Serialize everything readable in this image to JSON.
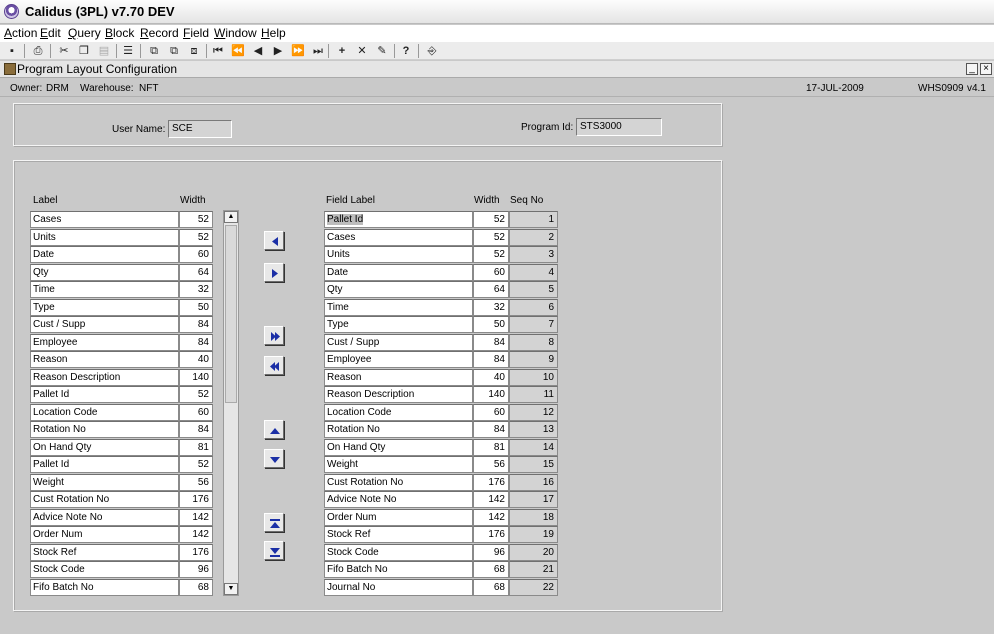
{
  "window": {
    "title": "Calidus (3PL) v7.70 DEV"
  },
  "menu": [
    {
      "label": "Action",
      "u": "A",
      "rest": "ction"
    },
    {
      "label": "Edit",
      "u": "E",
      "rest": "dit"
    },
    {
      "label": "Query",
      "u": "Q",
      "rest": "uery"
    },
    {
      "label": "Block",
      "u": "B",
      "rest": "lock"
    },
    {
      "label": "Record",
      "u": "R",
      "rest": "ecord"
    },
    {
      "label": "Field",
      "u": "F",
      "rest": "ield"
    },
    {
      "label": "Window",
      "u": "W",
      "rest": "indow"
    },
    {
      "label": "Help",
      "u": "H",
      "rest": "elp"
    }
  ],
  "form": {
    "title": "Program Layout Configuration",
    "owner_label": "Owner:",
    "owner_value": "DRM",
    "warehouse_label": "Warehouse:",
    "warehouse_value": "NFT",
    "date": "17-JUL-2009",
    "screen_id": "WHS0909",
    "version": "v4.1"
  },
  "header_panel": {
    "user_name_label": "User Name:",
    "user_name_value": "SCE",
    "program_id_label": "Program Id:",
    "program_id_value": "STS3000"
  },
  "available": {
    "col_label": "Label",
    "col_width": "Width",
    "rows": [
      {
        "label": "Cases",
        "width": "52"
      },
      {
        "label": "Units",
        "width": "52"
      },
      {
        "label": "Date",
        "width": "60"
      },
      {
        "label": "Qty",
        "width": "64"
      },
      {
        "label": "Time",
        "width": "32"
      },
      {
        "label": "Type",
        "width": "50"
      },
      {
        "label": "Cust / Supp",
        "width": "84"
      },
      {
        "label": "Employee",
        "width": "84"
      },
      {
        "label": "Reason",
        "width": "40"
      },
      {
        "label": "Reason Description",
        "width": "140"
      },
      {
        "label": "Pallet Id",
        "width": "52"
      },
      {
        "label": "Location Code",
        "width": "60"
      },
      {
        "label": "Rotation No",
        "width": "84"
      },
      {
        "label": "On Hand Qty",
        "width": "81"
      },
      {
        "label": "Pallet Id",
        "width": "52"
      },
      {
        "label": "Weight",
        "width": "56"
      },
      {
        "label": "Cust Rotation No",
        "width": "176"
      },
      {
        "label": "Advice Note No",
        "width": "142"
      },
      {
        "label": "Order Num",
        "width": "142"
      },
      {
        "label": "Stock Ref",
        "width": "176"
      },
      {
        "label": "Stock Code",
        "width": "96"
      },
      {
        "label": "Fifo Batch No",
        "width": "68"
      }
    ]
  },
  "selected": {
    "col_label": "Field Label",
    "col_width": "Width",
    "col_seq": "Seq No",
    "rows": [
      {
        "label": "Pallet Id",
        "width": "52",
        "seq": "1"
      },
      {
        "label": "Cases",
        "width": "52",
        "seq": "2"
      },
      {
        "label": "Units",
        "width": "52",
        "seq": "3"
      },
      {
        "label": "Date",
        "width": "60",
        "seq": "4"
      },
      {
        "label": "Qty",
        "width": "64",
        "seq": "5"
      },
      {
        "label": "Time",
        "width": "32",
        "seq": "6"
      },
      {
        "label": "Type",
        "width": "50",
        "seq": "7"
      },
      {
        "label": "Cust / Supp",
        "width": "84",
        "seq": "8"
      },
      {
        "label": "Employee",
        "width": "84",
        "seq": "9"
      },
      {
        "label": "Reason",
        "width": "40",
        "seq": "10"
      },
      {
        "label": "Reason Description",
        "width": "140",
        "seq": "11"
      },
      {
        "label": "Location Code",
        "width": "60",
        "seq": "12"
      },
      {
        "label": "Rotation No",
        "width": "84",
        "seq": "13"
      },
      {
        "label": "On Hand Qty",
        "width": "81",
        "seq": "14"
      },
      {
        "label": "Weight",
        "width": "56",
        "seq": "15"
      },
      {
        "label": "Cust Rotation No",
        "width": "176",
        "seq": "16"
      },
      {
        "label": "Advice Note No",
        "width": "142",
        "seq": "17"
      },
      {
        "label": "Order Num",
        "width": "142",
        "seq": "18"
      },
      {
        "label": "Stock Ref",
        "width": "176",
        "seq": "19"
      },
      {
        "label": "Stock Code",
        "width": "96",
        "seq": "20"
      },
      {
        "label": "Fifo Batch No",
        "width": "68",
        "seq": "21"
      },
      {
        "label": "Journal No",
        "width": "68",
        "seq": "22"
      }
    ]
  },
  "arrow_buttons": [
    {
      "name": "move-left-button",
      "icon": "arrow-left-icon"
    },
    {
      "name": "move-right-button",
      "icon": "arrow-right-icon"
    },
    {
      "name": "move-all-right-button",
      "icon": "double-arrow-right-icon"
    },
    {
      "name": "move-all-left-button",
      "icon": "double-arrow-left-icon"
    },
    {
      "name": "move-up-button",
      "icon": "arrow-up-icon"
    },
    {
      "name": "move-down-button",
      "icon": "arrow-down-icon"
    },
    {
      "name": "move-top-button",
      "icon": "arrow-top-icon"
    },
    {
      "name": "move-bottom-button",
      "icon": "arrow-bottom-icon"
    }
  ],
  "colors": {
    "arrow_blue": "#1b2fa6",
    "field_grey": "#d4d4d4"
  }
}
